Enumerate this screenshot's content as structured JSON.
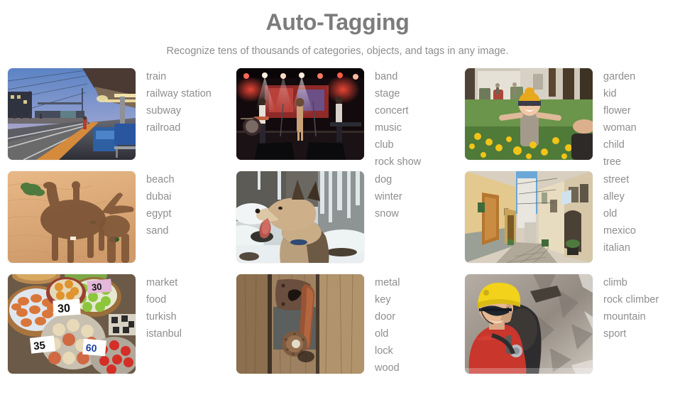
{
  "header": {
    "title": "Auto-Tagging",
    "subtitle": "Recognize tens of thousands of categories, objects, and tags in any image."
  },
  "colors": {
    "title": "#7c7c7c",
    "text": "#8e8e8e",
    "background": "#ffffff"
  },
  "cells": [
    {
      "image_name": "train-platform-photo",
      "image_alt": "railway station platform at dusk with tracks",
      "tags": [
        "train",
        "railway station",
        "subway",
        "railroad"
      ]
    },
    {
      "image_name": "concert-stage-photo",
      "image_alt": "band performing on a lit concert stage",
      "tags": [
        "band",
        "stage",
        "concert",
        "music",
        "club",
        "rock show"
      ]
    },
    {
      "image_name": "child-garden-photo",
      "image_alt": "smiling child in knit hat among yellow flowers",
      "tags": [
        "garden",
        "kid",
        "flower",
        "woman",
        "child",
        "tree"
      ]
    },
    {
      "image_name": "camel-shadow-photo",
      "image_alt": "shadow of camel and rider on desert sand",
      "tags": [
        "beach",
        "dubai",
        "egypt",
        "sand"
      ]
    },
    {
      "image_name": "dog-snow-photo",
      "image_alt": "husky dog in snow with tongue out",
      "tags": [
        "dog",
        "winter",
        "snow"
      ]
    },
    {
      "image_name": "alley-street-photo",
      "image_alt": "narrow old european alley with yellow walls",
      "tags": [
        "street",
        "alley",
        "old",
        "mexico",
        "italian"
      ]
    },
    {
      "image_name": "market-fruit-photo",
      "image_alt": "market stall baskets of fruit with price signs",
      "tags": [
        "market",
        "food",
        "turkish",
        "istanbul"
      ]
    },
    {
      "image_name": "door-lock-photo",
      "image_alt": "rusty metal latch on weathered wooden door",
      "tags": [
        "metal",
        "key",
        "door",
        "old",
        "lock",
        "wood"
      ]
    },
    {
      "image_name": "rock-climber-photo",
      "image_alt": "climber in yellow helmet on mountain rock face",
      "tags": [
        "climb",
        "rock climber",
        "mountain",
        "sport"
      ]
    }
  ]
}
